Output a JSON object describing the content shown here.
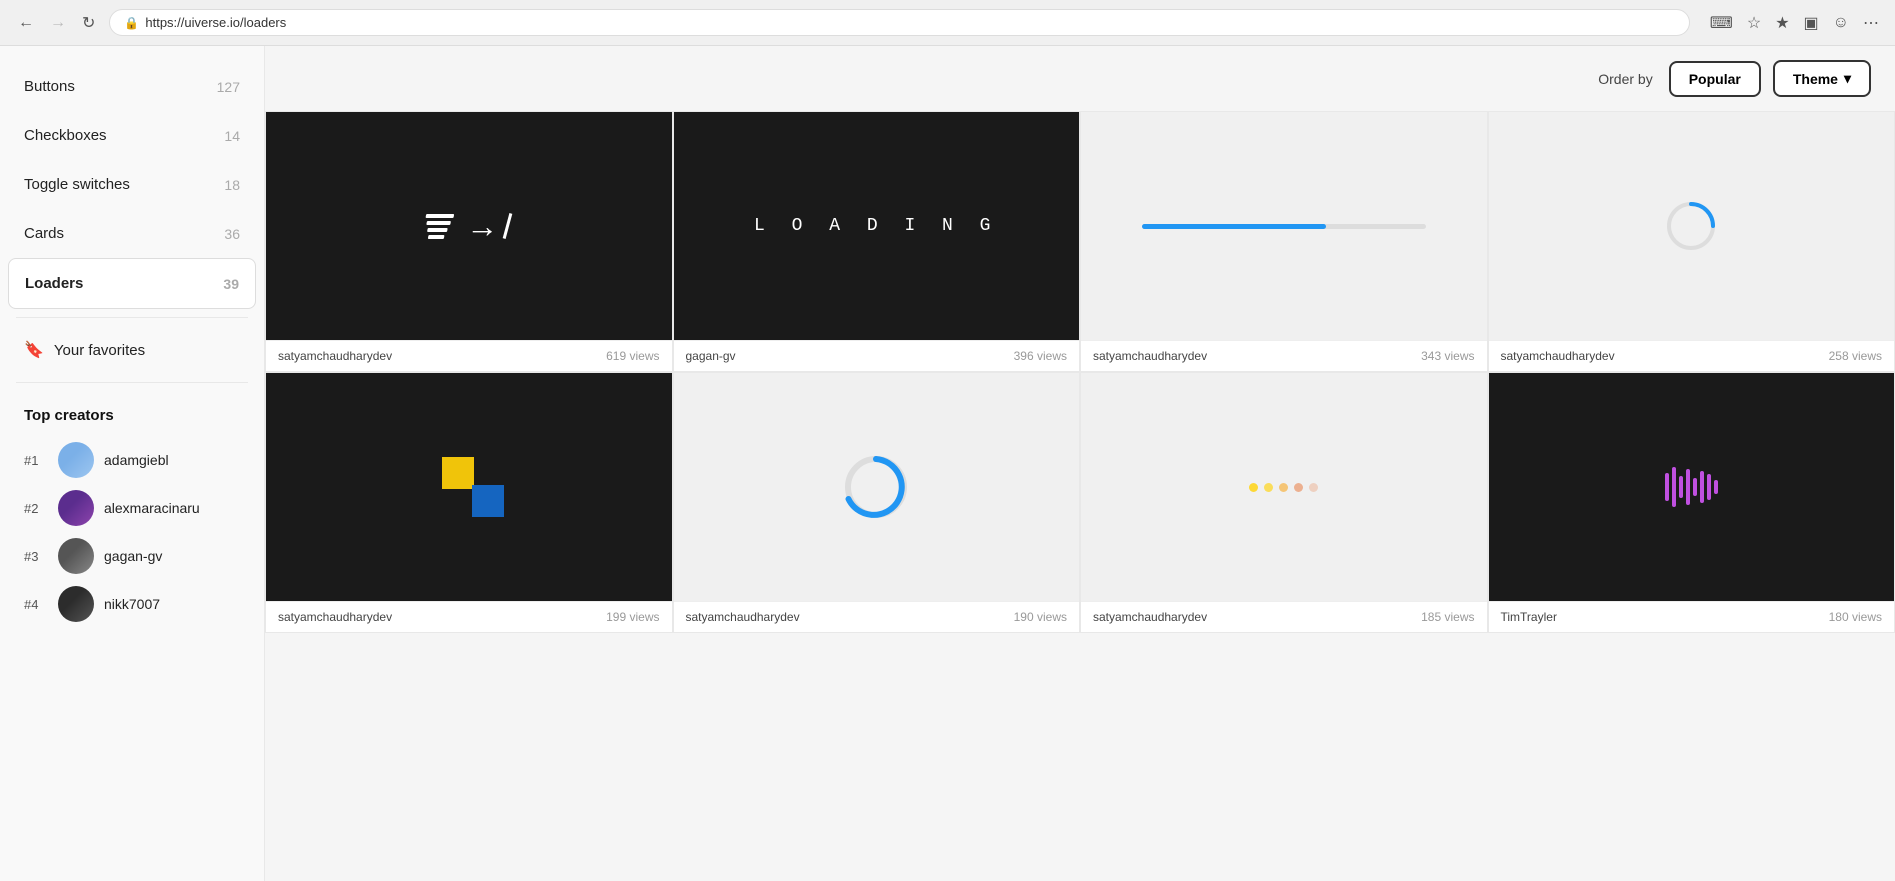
{
  "browser": {
    "back_disabled": false,
    "forward_disabled": true,
    "url": "https://uiverse.io/loaders",
    "actions": [
      "read-aloud",
      "favorites",
      "star",
      "collections",
      "profile",
      "more"
    ]
  },
  "header": {
    "order_by_label": "Order by",
    "popular_btn": "Popular",
    "theme_btn": "Theme",
    "chevron": "▾"
  },
  "sidebar": {
    "items": [
      {
        "label": "Buttons",
        "count": "127"
      },
      {
        "label": "Checkboxes",
        "count": "14"
      },
      {
        "label": "Toggle switches",
        "count": "18"
      },
      {
        "label": "Cards",
        "count": "36"
      },
      {
        "label": "Loaders",
        "count": "39",
        "active": true
      }
    ],
    "favorites": "Your favorites",
    "top_creators_title": "Top creators",
    "creators": [
      {
        "rank": "#1",
        "name": "adamgiebl"
      },
      {
        "rank": "#2",
        "name": "alexmaracinaru"
      },
      {
        "rank": "#3",
        "name": "gagan-gv"
      },
      {
        "rank": "#4",
        "name": "nikk7007"
      }
    ]
  },
  "grid": {
    "cards": [
      {
        "author": "satyamchaudharydev",
        "views": "619 views",
        "theme": "dark"
      },
      {
        "author": "gagan-gv",
        "views": "396 views",
        "theme": "dark"
      },
      {
        "author": "satyamchaudharydev",
        "views": "343 views",
        "theme": "light"
      },
      {
        "author": "satyamchaudharydev",
        "views": "258 views",
        "theme": "light"
      },
      {
        "author": "satyamchaudharydev",
        "views": "199 views",
        "theme": "dark"
      },
      {
        "author": "satyamchaudharydev",
        "views": "190 views",
        "theme": "light"
      },
      {
        "author": "satyamchaudharydev",
        "views": "185 views",
        "theme": "light"
      },
      {
        "author": "TimTrayler",
        "views": "180 views",
        "theme": "dark"
      }
    ]
  }
}
